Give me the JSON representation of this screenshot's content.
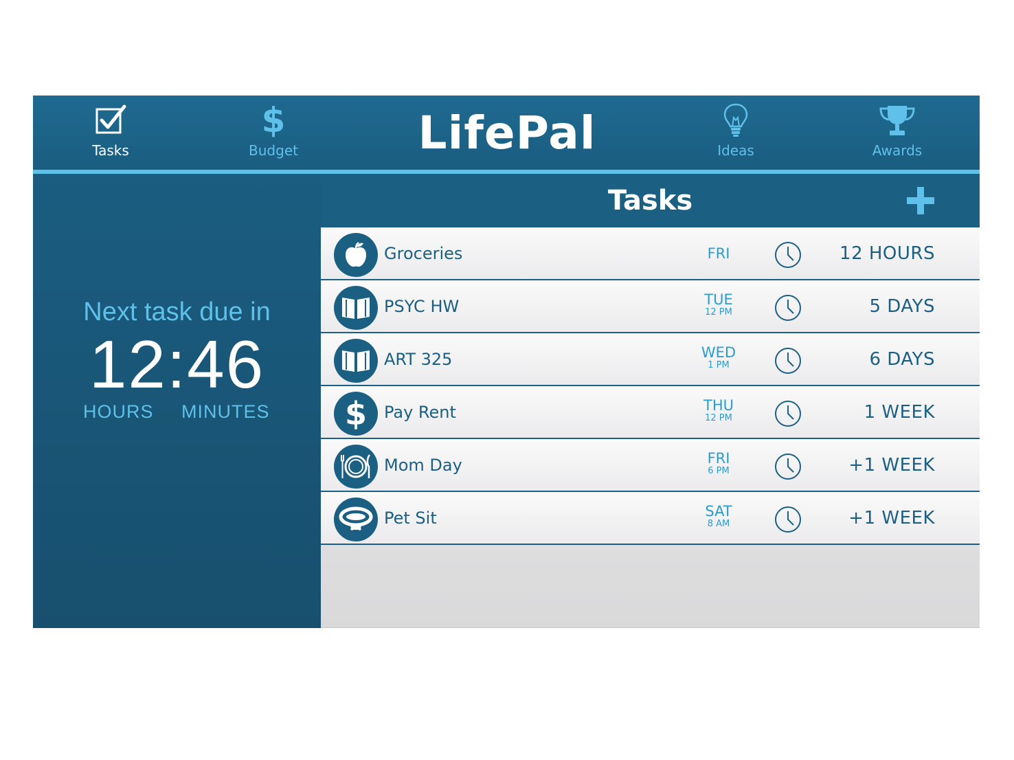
{
  "app": {
    "title": "LifePal"
  },
  "nav": {
    "tasks": {
      "label": "Tasks",
      "icon": "checkbox-icon"
    },
    "budget": {
      "label": "Budget",
      "icon": "dollar-icon"
    },
    "ideas": {
      "label": "Ideas",
      "icon": "lightbulb-icon"
    },
    "awards": {
      "label": "Awards",
      "icon": "trophy-icon"
    }
  },
  "countdown": {
    "caption": "Next task due in",
    "time": "12:46",
    "hours_label": "HOURS",
    "minutes_label": "MINUTES"
  },
  "tasks": {
    "title": "Tasks",
    "items": [
      {
        "name": "Groceries",
        "icon": "apple-icon",
        "day": "FRI",
        "time": "",
        "eta": "12 HOURS"
      },
      {
        "name": "PSYC HW",
        "icon": "book-icon",
        "day": "TUE",
        "time": "12 PM",
        "eta": "5 DAYS"
      },
      {
        "name": "ART 325",
        "icon": "book-icon",
        "day": "WED",
        "time": "1 PM",
        "eta": "6 DAYS"
      },
      {
        "name": "Pay Rent",
        "icon": "dollar-icon",
        "day": "THU",
        "time": "12 PM",
        "eta": "1 WEEK"
      },
      {
        "name": "Mom Day",
        "icon": "plate-icon",
        "day": "FRI",
        "time": "6 PM",
        "eta": "+1 WEEK"
      },
      {
        "name": "Pet Sit",
        "icon": "pet-collar-icon",
        "day": "SAT",
        "time": "8 AM",
        "eta": "+1 WEEK"
      }
    ]
  },
  "colors": {
    "primary": "#1b5f83",
    "accent": "#5fc0ea",
    "day_text": "#2a9cce",
    "list_background": "#f0f0f1"
  }
}
